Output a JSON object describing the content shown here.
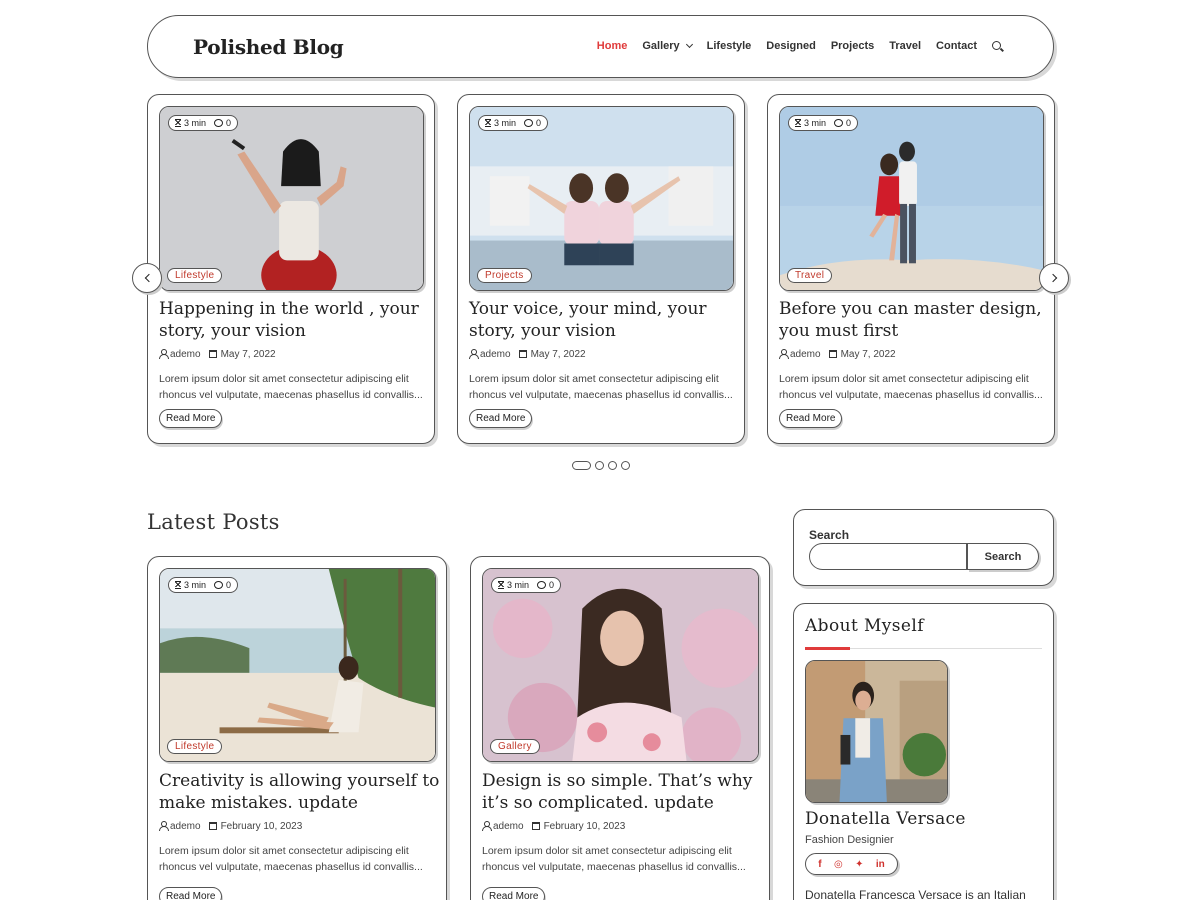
{
  "header": {
    "logo": "Polished Blog",
    "nav": [
      {
        "label": "Home",
        "active": true
      },
      {
        "label": "Gallery",
        "dropdown": true
      },
      {
        "label": "Lifestyle"
      },
      {
        "label": "Designed"
      },
      {
        "label": "Projects"
      },
      {
        "label": "Travel"
      },
      {
        "label": "Contact"
      }
    ],
    "search_icon": "search-icon"
  },
  "slider": {
    "cards": [
      {
        "read_time": "3 min",
        "comments": "0",
        "category": "Lifestyle",
        "title_l1": "Happening in the world , your",
        "title_l2": "story, your vision",
        "author": "ademo",
        "date": "May 7, 2022",
        "excerpt_l1": "Lorem ipsum dolor sit amet consectetur adipiscing elit",
        "excerpt_l2": "rhoncus vel vulputate, maecenas phasellus id convallis...",
        "read_more": "Read More"
      },
      {
        "read_time": "3 min",
        "comments": "0",
        "category": "Projects",
        "title_l1": "Your voice, your mind, your",
        "title_l2": "story, your vision",
        "author": "ademo",
        "date": "May 7, 2022",
        "excerpt_l1": "Lorem ipsum dolor sit amet consectetur adipiscing elit",
        "excerpt_l2": "rhoncus vel vulputate, maecenas phasellus id convallis...",
        "read_more": "Read More"
      },
      {
        "read_time": "3 min",
        "comments": "0",
        "category": "Travel",
        "title_l1": "Before you can master design,",
        "title_l2": "you must first",
        "author": "ademo",
        "date": "May 7, 2022",
        "excerpt_l1": "Lorem ipsum dolor sit amet consectetur adipiscing elit",
        "excerpt_l2": "rhoncus vel vulputate, maecenas phasellus id convallis...",
        "read_more": "Read More"
      }
    ],
    "pagination_total": 4,
    "pagination_active": 1
  },
  "latest": {
    "title": "Latest Posts",
    "posts": [
      {
        "read_time": "3 min",
        "comments": "0",
        "category": "Lifestyle",
        "title_l1": "Creativity is allowing yourself to",
        "title_l2": "make mistakes. update",
        "author": "ademo",
        "date": "February 10, 2023",
        "excerpt_l1": "Lorem ipsum dolor sit amet consectetur adipiscing elit",
        "excerpt_l2": "rhoncus vel vulputate, maecenas phasellus id convallis...",
        "read_more": "Read More"
      },
      {
        "read_time": "3 min",
        "comments": "0",
        "category": "Gallery",
        "title_l1": "Design is so simple. That’s why",
        "title_l2": "it’s so complicated. update",
        "author": "ademo",
        "date": "February 10, 2023",
        "excerpt_l1": "Lorem ipsum dolor sit amet consectetur adipiscing elit",
        "excerpt_l2": "rhoncus vel vulputate, maecenas phasellus id convallis...",
        "read_more": "Read More"
      }
    ]
  },
  "sidebar": {
    "search_label": "Search",
    "search_value": "",
    "search_button": "Search",
    "about_title": "About Myself",
    "name": "Donatella Versace",
    "role": "Fashion Designier",
    "social": [
      "facebook-icon",
      "instagram-icon",
      "twitter-icon",
      "linkedin-icon"
    ],
    "bio": "Donatella Francesca Versace is an Italian"
  },
  "colors": {
    "accent": "#e03b3b",
    "border": "#555555",
    "shadow": "#d8d8d8"
  }
}
